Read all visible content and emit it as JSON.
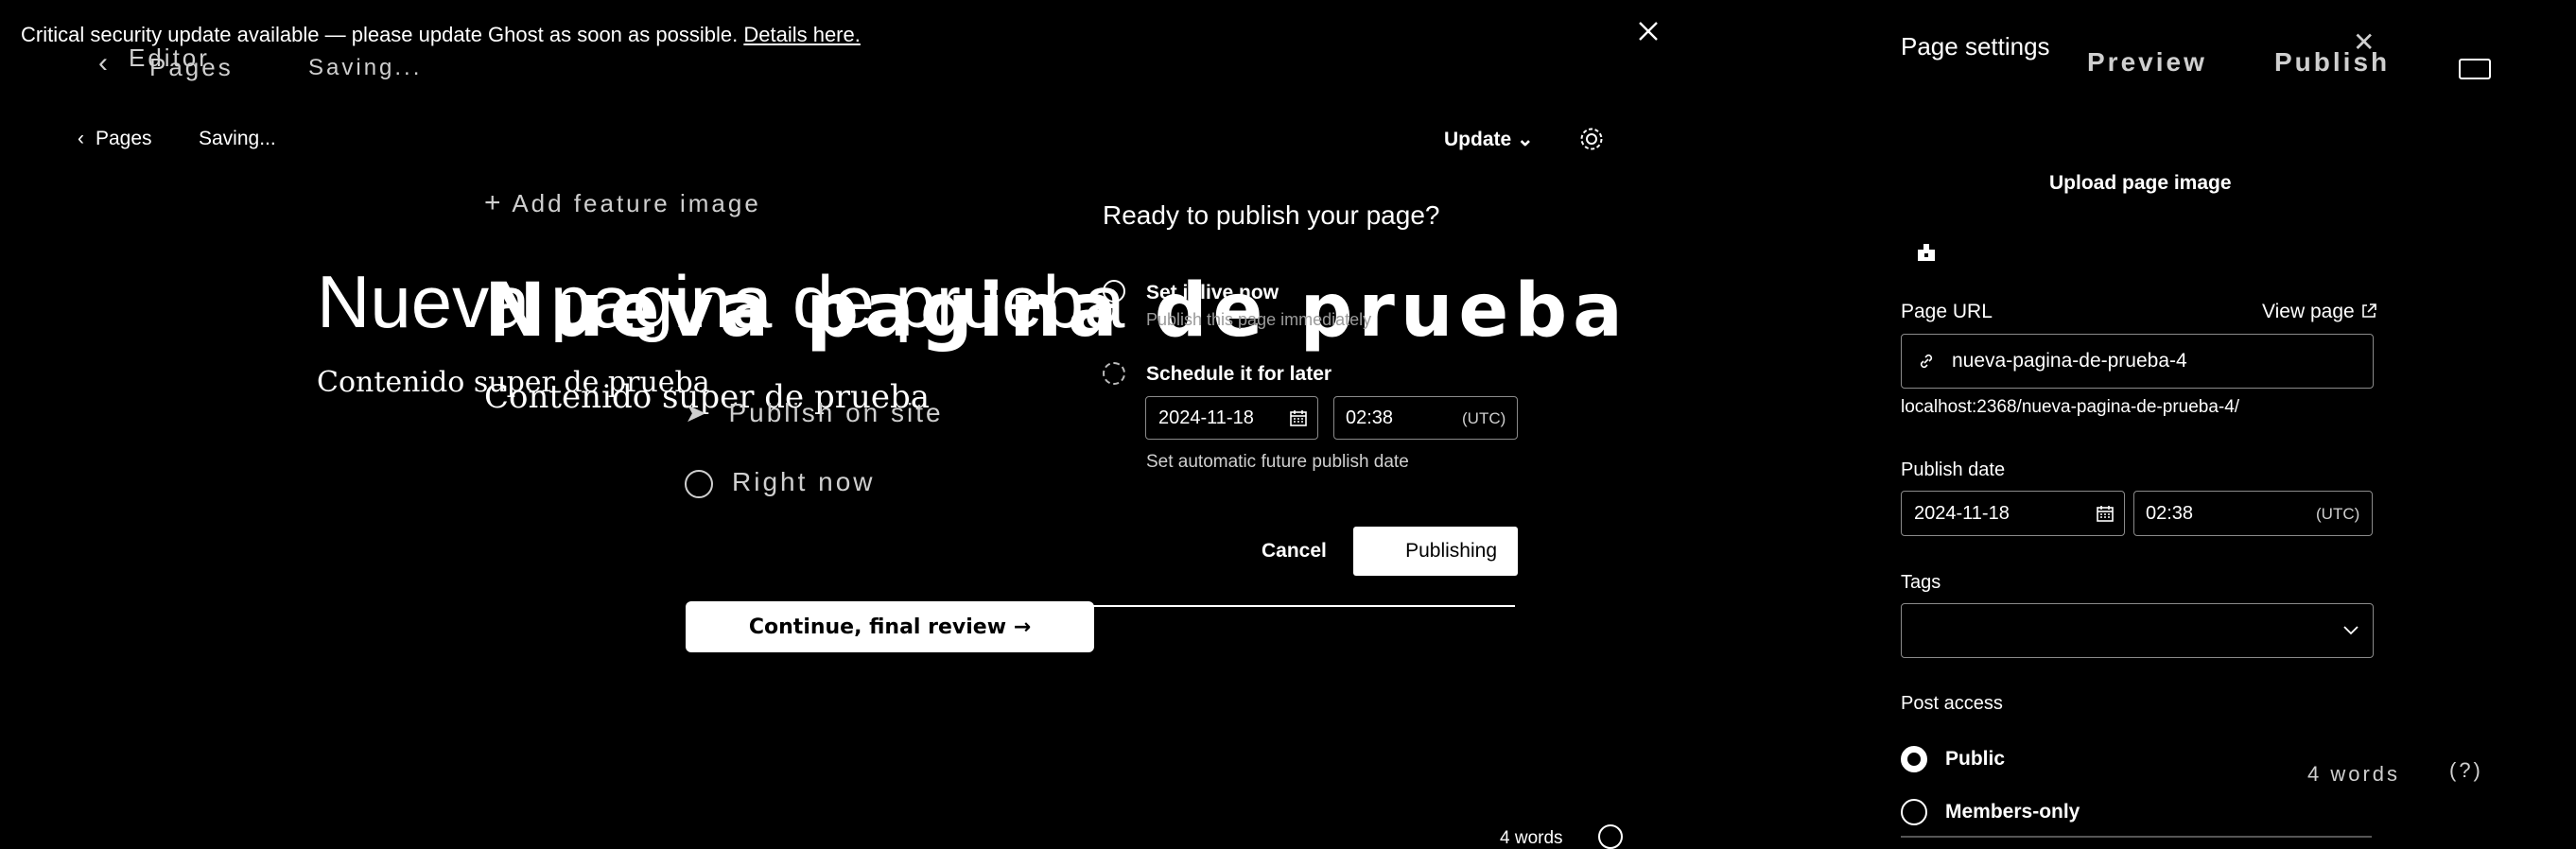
{
  "banner": {
    "text": "Critical security update available — please update Ghost as soon as possible.",
    "link": "Details here."
  },
  "ghost_layer": {
    "back_label": "Pages",
    "editor_label": "Editor",
    "saving": "Saving...",
    "add_feature_image": "Add feature image",
    "title": "Nueva pagina de prueba",
    "body": "Contenido super de prueba",
    "publish_on_site": "Publish on site",
    "right_now": "Right now",
    "continue_button": "Continue, final review →",
    "preview": "Preview",
    "publish": "Publish",
    "word_count": "4 words"
  },
  "editor": {
    "back_label": "Pages",
    "status": "Saving...",
    "update_label": "Update",
    "title": "Nueva pagina de prueba",
    "body": "Contenido super de prueba",
    "word_count": "4 words"
  },
  "modal": {
    "heading": "Ready to publish your page?",
    "option_now_label": "Set it live now",
    "option_now_desc": "Publish this page immediately",
    "option_later_label": "Schedule it for later",
    "date": "2024-11-18",
    "time": "02:38",
    "timezone": "(UTC)",
    "hint": "Set automatic future publish date",
    "cancel": "Cancel",
    "publishing": "Publishing"
  },
  "sidebar": {
    "title": "Page settings",
    "upload_image": "Upload page image",
    "page_url_label": "Page URL",
    "view_page": "View page",
    "slug": "nueva-pagina-de-prueba-4",
    "full_url": "localhost:2368/nueva-pagina-de-prueba-4/",
    "publish_date_label": "Publish date",
    "publish_date": "2024-11-18",
    "publish_time": "02:38",
    "timezone": "(UTC)",
    "tags_label": "Tags",
    "post_access_label": "Post access",
    "access_options": [
      "Public",
      "Members-only"
    ],
    "access_selected": "Public"
  },
  "icons": {
    "close": "close-icon",
    "gear": "gear-icon",
    "calendar": "calendar-icon",
    "link": "link-icon",
    "external": "external-link-icon",
    "chevron": "chevron-down-icon",
    "sidebar_toggle": "sidebar-toggle-icon",
    "image": "image-icon",
    "help": "help-icon"
  }
}
